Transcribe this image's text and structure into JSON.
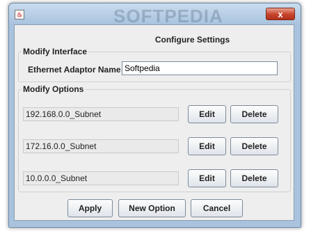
{
  "titlebar": {
    "icon": "java-coffee-icon",
    "watermark": "SOFTPEDIA",
    "close_label": "x"
  },
  "dialog": {
    "heading": "Configure Settings"
  },
  "modify_interface": {
    "title": "Modify Interface",
    "adaptor_label": "Ethernet Adaptor Name",
    "adaptor_value": "Softpedia"
  },
  "modify_options": {
    "title": "Modify Options",
    "rows": [
      {
        "subnet": "192.168.0.0_Subnet",
        "edit": "Edit",
        "delete": "Delete"
      },
      {
        "subnet": "172.16.0.0_Subnet",
        "edit": "Edit",
        "delete": "Delete"
      },
      {
        "subnet": "10.0.0.0_Subnet",
        "edit": "Edit",
        "delete": "Delete"
      }
    ]
  },
  "footer": {
    "apply": "Apply",
    "new_option": "New Option",
    "cancel": "Cancel"
  }
}
